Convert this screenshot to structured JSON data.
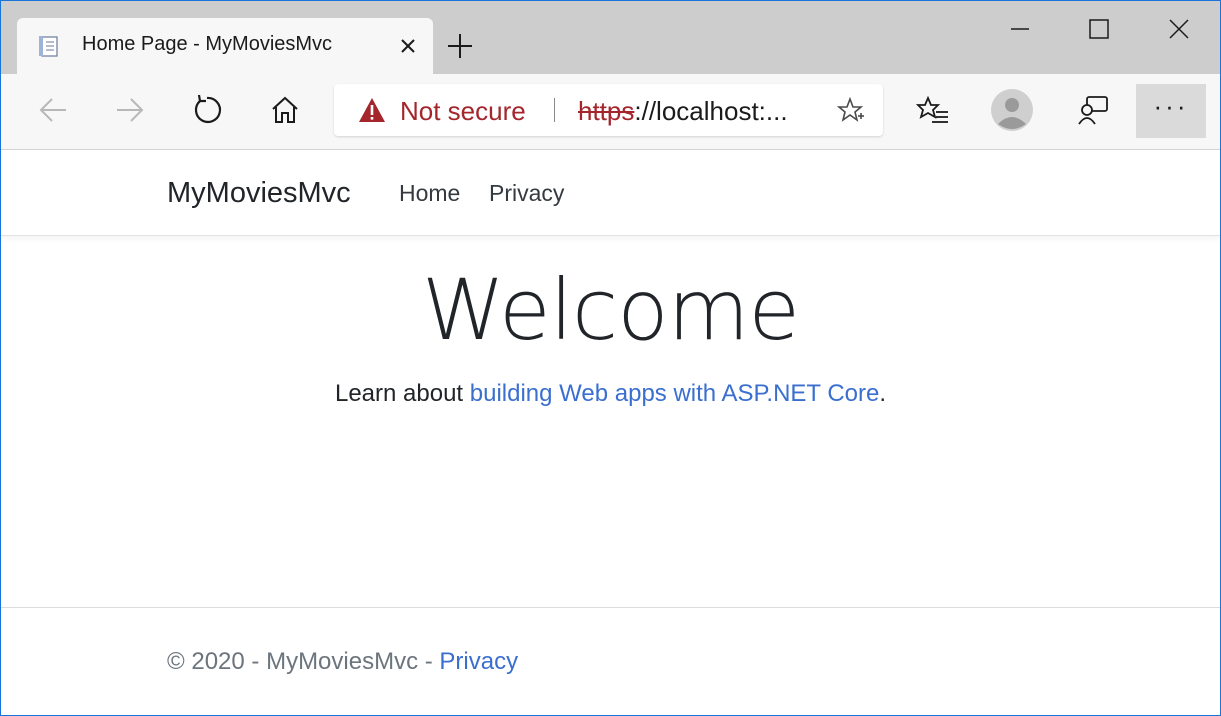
{
  "browser": {
    "tab": {
      "title": "Home Page - MyMoviesMvc",
      "favicon": "page-icon",
      "close_icon": "close-icon"
    },
    "new_tab_icon": "plus-icon",
    "window_controls": [
      "minimize-icon",
      "maximize-icon",
      "close-icon"
    ],
    "toolbar": {
      "back_icon": "arrow-left-icon",
      "forward_icon": "arrow-right-icon",
      "refresh_icon": "refresh-icon",
      "home_icon": "home-icon",
      "favorites_icon": "favorites-list-icon",
      "profile_icon": "avatar-icon",
      "feedback_icon": "feedback-icon",
      "more_label": "···"
    },
    "address_bar": {
      "security_label": "Not secure",
      "url_scheme": "https",
      "url_rest": "://localhost:...",
      "favorite_icon": "star-add-icon"
    },
    "colors": {
      "warning": "#a4262c",
      "link": "#3a6fcf",
      "frame_border": "#1a73d9"
    }
  },
  "site": {
    "brand": "MyMoviesMvc",
    "nav": [
      {
        "label": "Home"
      },
      {
        "label": "Privacy"
      }
    ],
    "main": {
      "heading": "Welcome",
      "lead_prefix": "Learn about ",
      "lead_link": "building Web apps with ASP.NET Core",
      "lead_suffix": "."
    },
    "footer": {
      "copyright": "© 2020 - MyMoviesMvc - ",
      "privacy_link": "Privacy"
    }
  }
}
